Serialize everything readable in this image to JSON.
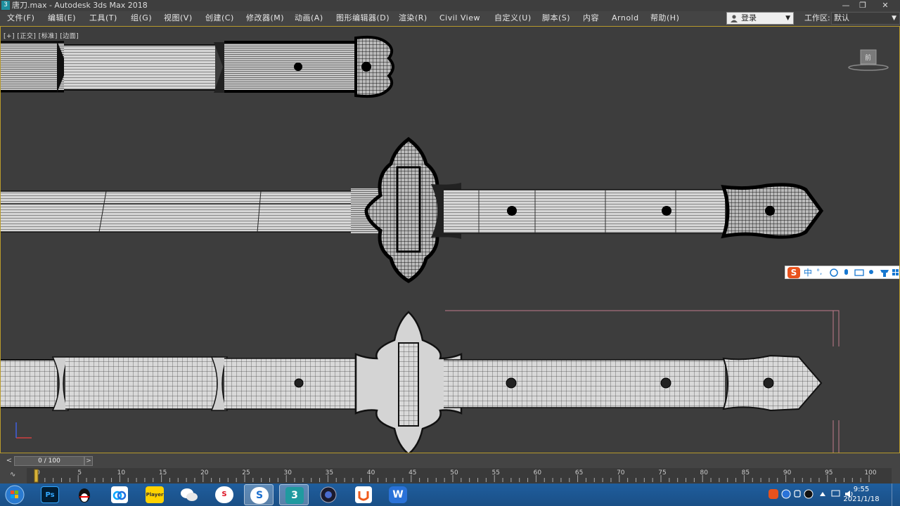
{
  "window": {
    "app_icon": "3",
    "title": "唐刀.max - Autodesk 3ds Max 2018",
    "controls": {
      "minimize": "—",
      "restore": "❐",
      "close": "✕"
    }
  },
  "menubar": {
    "items": [
      "文件(F)",
      "编辑(E)",
      "工具(T)",
      "组(G)",
      "视图(V)",
      "创建(C)",
      "修改器(M)",
      "动画(A)",
      "图形编辑器(D)",
      "渲染(R)",
      "Civil View",
      "自定义(U)",
      "脚本(S)",
      "内容",
      "Arnold",
      "帮助(H)"
    ],
    "login": "登录",
    "workspace_label": "工作区:",
    "workspace_value": "默认"
  },
  "viewport": {
    "label": "[+] [正交] [标准] [边面]",
    "viewcube_label": "前",
    "ime_toolbar": {
      "logo": "S",
      "mode": "中",
      "punct": "°,"
    },
    "colors": {
      "background": "#3d3d3d",
      "active_border": "#b89a2c",
      "wire": "#111111",
      "shaded": "#cfcfcf",
      "safe_frame": "#c07a8c"
    }
  },
  "trackbar": {
    "prev_button": "<",
    "next_button": ">",
    "frame_display": "0 / 100"
  },
  "timeline": {
    "ticks": [
      "0",
      "5",
      "10",
      "15",
      "20",
      "25",
      "30",
      "35",
      "40",
      "45",
      "50",
      "55",
      "60",
      "65",
      "70",
      "75",
      "80",
      "85",
      "90",
      "95",
      "100"
    ],
    "current_frame": 0
  },
  "taskbar": {
    "apps": [
      {
        "name": "start-button",
        "label": ""
      },
      {
        "name": "photoshop",
        "label": "Ps"
      },
      {
        "name": "qq",
        "label": ""
      },
      {
        "name": "baidu-netdisk",
        "label": ""
      },
      {
        "name": "player",
        "label": "Player"
      },
      {
        "name": "wechat",
        "label": ""
      },
      {
        "name": "substance",
        "label": "S"
      },
      {
        "name": "sogou",
        "label": "S"
      },
      {
        "name": "3dsmax",
        "label": "3"
      },
      {
        "name": "cinema4d",
        "label": ""
      },
      {
        "name": "ucloud",
        "label": ""
      },
      {
        "name": "wps",
        "label": "W"
      }
    ],
    "clock": {
      "time": "9:55",
      "date": "2021/1/18"
    }
  }
}
